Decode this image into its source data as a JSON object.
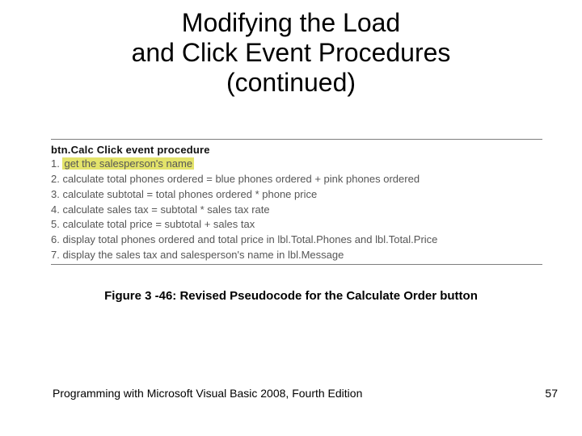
{
  "title_line1": "Modifying the Load",
  "title_line2": "and Click Event Procedures",
  "title_line3": "(continued)",
  "procedure_title": "btn.Calc Click event procedure",
  "steps": {
    "s1_num": "1. ",
    "s1_text": "get the salesperson's name",
    "s2": "2. calculate total phones ordered = blue phones ordered + pink phones ordered",
    "s3": "3. calculate subtotal = total phones ordered * phone price",
    "s4": "4. calculate sales tax = subtotal * sales tax rate",
    "s5": "5. calculate total price = subtotal + sales tax",
    "s6": "6. display total phones ordered and total price in lbl.Total.Phones and lbl.Total.Price",
    "s7": "7. display the sales tax and salesperson's name in lbl.Message"
  },
  "caption": "Figure 3 -46: Revised Pseudocode for the Calculate Order button",
  "footer": {
    "left": "Programming with Microsoft Visual Basic 2008, Fourth Edition",
    "page": "57"
  }
}
